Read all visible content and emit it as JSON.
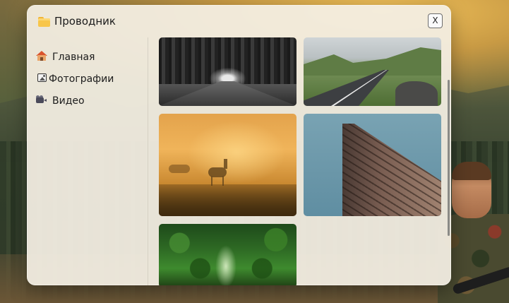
{
  "window": {
    "title": "Проводник",
    "close_label": "X"
  },
  "sidebar": {
    "items": [
      {
        "label": "Главная",
        "icon": "house-icon"
      },
      {
        "label": "Фотографии",
        "icon": "photo-icon"
      },
      {
        "label": "Видео",
        "icon": "video-camera-icon"
      }
    ]
  },
  "gallery": {
    "images": [
      {
        "icon": "tree-tunnel-road-bw-photo"
      },
      {
        "icon": "mountain-road-photo"
      },
      {
        "icon": "foggy-deer-photo"
      },
      {
        "icon": "flatiron-building-photo"
      },
      {
        "icon": "green-forest-path-photo"
      }
    ]
  },
  "colors": {
    "window_bg": "#f3eee2",
    "folder_icon": "#f8c64a",
    "text": "#1c1c1c"
  }
}
